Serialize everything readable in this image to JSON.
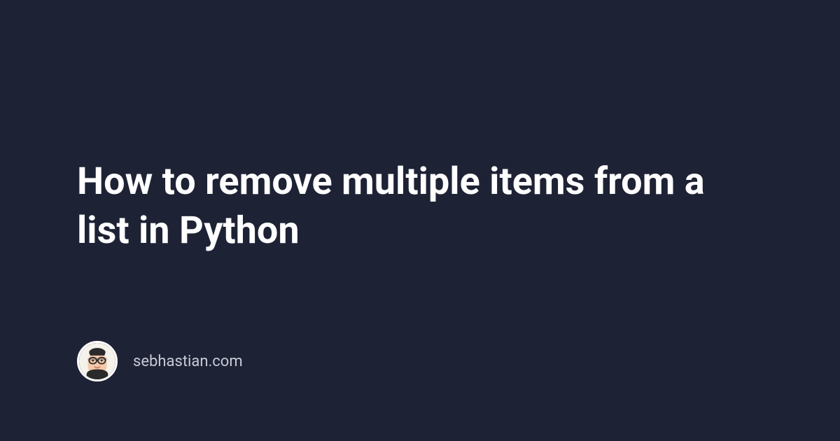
{
  "title": "How to remove multiple items from a list in Python",
  "author": {
    "site": "sebhastian.com"
  }
}
